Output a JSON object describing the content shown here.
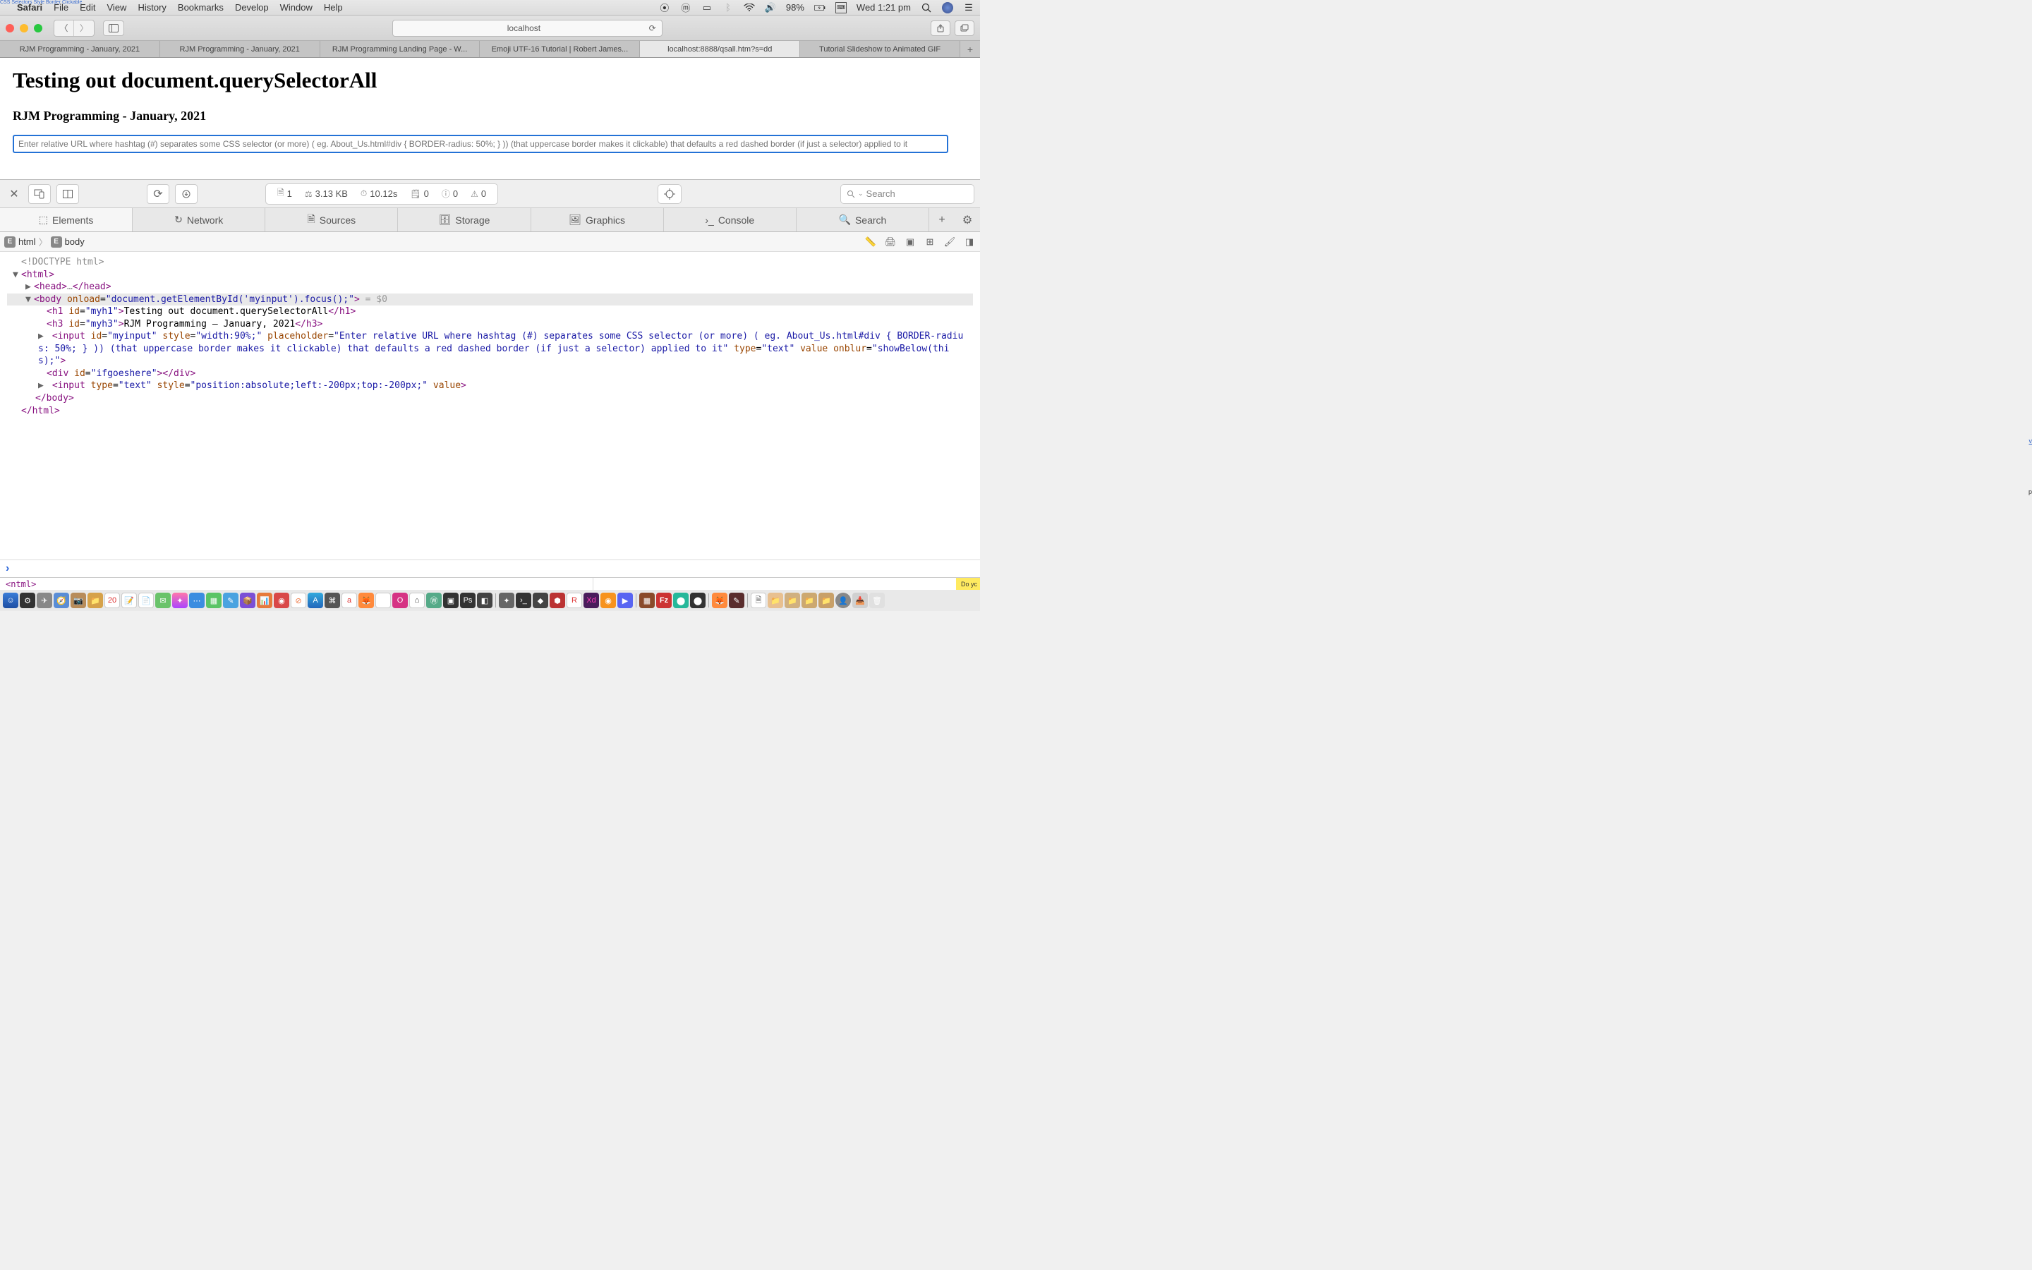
{
  "overlay_text": "CSS Selectors",
  "overlay_text2": "Style Border Clickable",
  "menubar": {
    "app": "Safari",
    "items": [
      "File",
      "Edit",
      "View",
      "History",
      "Bookmarks",
      "Develop",
      "Window",
      "Help"
    ],
    "battery": "98%",
    "datetime": "Wed 1:21 pm"
  },
  "safari": {
    "url": "localhost",
    "tabs": [
      "RJM Programming - January, 2021",
      "RJM Programming - January, 2021",
      "RJM Programming Landing Page - W...",
      "Emoji UTF-16 Tutorial | Robert James...",
      "localhost:8888/qsall.htm?s=dd",
      "Tutorial Slideshow to Animated GIF"
    ],
    "active_tab_index": 4
  },
  "page": {
    "h1": "Testing out document.querySelectorAll",
    "h3": "RJM Programming - January, 2021",
    "input_placeholder": "Enter relative URL where hashtag (#) separates some CSS selector (or more) ( eg. About_Us.html#div { BORDER-radius: 50%; } )) (that uppercase border makes it clickable) that defaults a red dashed border (if just a selector) applied to it"
  },
  "devtools": {
    "stats": {
      "docs": "1",
      "size": "3.13 KB",
      "time": "10.12s",
      "logs": "0",
      "errors": "0",
      "warnings": "0"
    },
    "search_placeholder": "Search",
    "tabs": [
      "Elements",
      "Network",
      "Sources",
      "Storage",
      "Graphics",
      "Console",
      "Search"
    ],
    "active_tab": "Elements",
    "breadcrumb": [
      "html",
      "body"
    ],
    "source": {
      "doctype": "<!DOCTYPE html>",
      "html_open": "<html>",
      "head": "<head>…</head>",
      "body_open_tag": "body",
      "body_onload_attr": "onload",
      "body_onload_val": "\"document.getElementById('myinput').focus();\"",
      "body_marker": " = $0",
      "h1_line_tag": "h1",
      "h1_id": "\"myh1\"",
      "h1_text": "Testing out document.querySelectorAll",
      "h3_tag": "h3",
      "h3_id": "\"myh3\"",
      "h3_text": "RJM Programming – January, 2021",
      "input1_raw": "<input id=\"myinput\" style=\"width:90%;\" placeholder=\"Enter relative URL where hashtag (#) separates some CSS selector (or more) ( eg. About_Us.html#div { BORDER-radius: 50%; } )) (that uppercase border makes it clickable) that defaults a red dashed border (if just a selector) applied to it\" type=\"text\" value onblur=\"showBelow(this);\">",
      "div_raw": "<div id=\"ifgoeshere\"></div>",
      "input2_raw": "<input type=\"text\" style=\"position:absolute;left:-200px;top:-200px;\" value>",
      "body_close": "</body>",
      "html_close": "</html>"
    }
  },
  "peek": {
    "left_code": "<ntml>",
    "right_text": "Do yc"
  }
}
